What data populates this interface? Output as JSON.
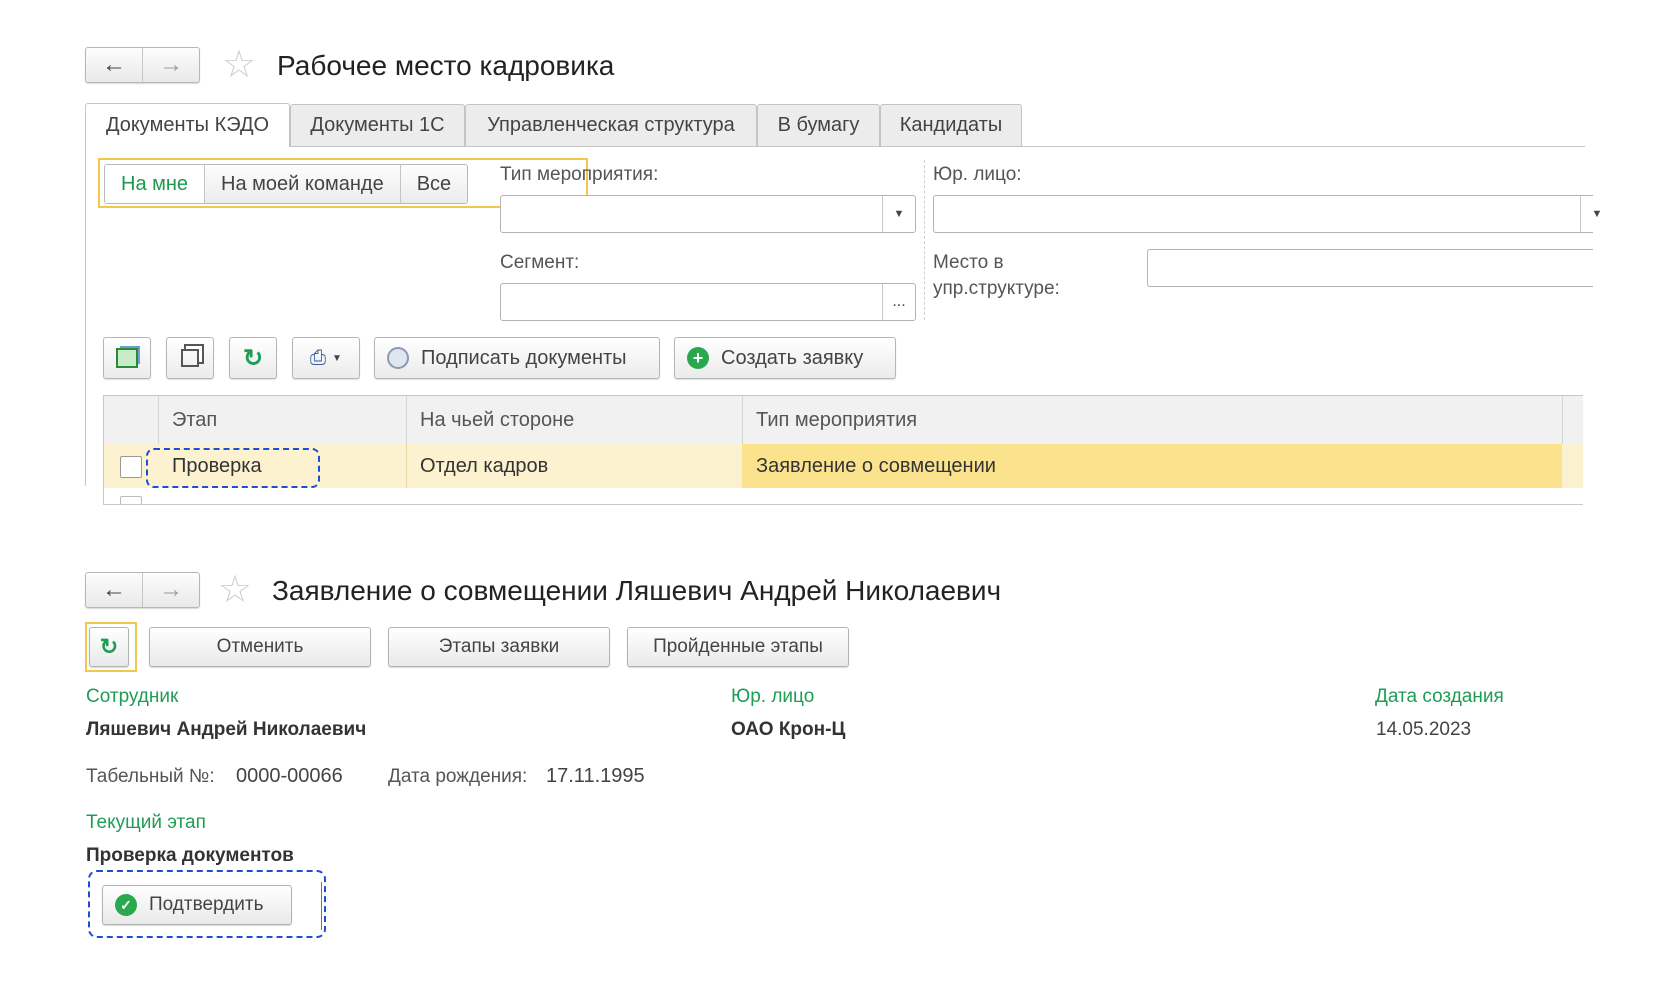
{
  "window1": {
    "title": "Рабочее место кадровика",
    "tabs": [
      "Документы КЭДО",
      "Документы 1С",
      "Управленческая структура",
      "В бумагу",
      "Кандидаты"
    ],
    "filter_buttons": [
      "На мне",
      "На моей команде",
      "Все"
    ],
    "event_type_label": "Тип мероприятия:",
    "legal_entity_label": "Юр. лицо:",
    "segment_label": "Сегмент:",
    "segment_select_glyph": "...",
    "place_label_line1": "Место в",
    "place_label_line2": "упр.структуре:",
    "sign_documents_label": "Подписать документы",
    "create_request_label": "Создать заявку",
    "table": {
      "headers": [
        "Этап",
        "На чьей стороне",
        "Тип мероприятия"
      ],
      "rows": [
        {
          "stage": "Проверка",
          "side": "Отдел кадров",
          "event_type": "Заявление о совмещении"
        }
      ]
    }
  },
  "window2": {
    "title": "Заявление о совмещении Ляшевич Андрей Николаевич",
    "buttons": {
      "cancel": "Отменить",
      "stages": "Этапы заявки",
      "passed_stages": "Пройденные этапы"
    },
    "employee_label": "Сотрудник",
    "employee_value": "Ляшевич Андрей Николаевич",
    "legal_entity_label": "Юр. лицо",
    "legal_entity_value": "ОАО Крон-Ц",
    "created_label": "Дата создания",
    "created_value": "14.05.2023",
    "tab_num_label": "Табельный №:",
    "tab_num_value": "0000-00066",
    "birth_label": "Дата рождения:",
    "birth_value": "17.11.1995",
    "current_stage_label": "Текущий этап",
    "current_stage_value": "Проверка документов",
    "confirm_label": "Подтвердить"
  },
  "colors": {
    "accent_green": "#1f9d55",
    "highlight_yellow": "#f3c748",
    "focus_blue": "#1a4fd6",
    "row_selected": "#fbe38e"
  }
}
